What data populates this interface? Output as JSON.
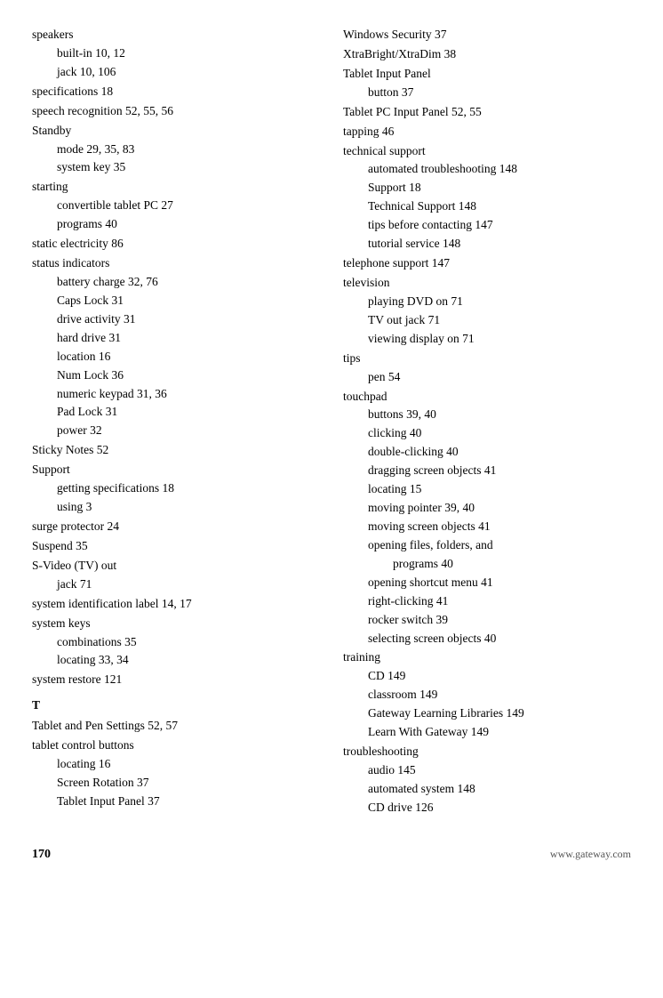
{
  "left_column": [
    {
      "type": "entry",
      "level": "main",
      "text": "speakers"
    },
    {
      "type": "entry",
      "level": "sub",
      "text": "built-in  10,  12"
    },
    {
      "type": "entry",
      "level": "sub",
      "text": "jack  10,  106"
    },
    {
      "type": "entry",
      "level": "main",
      "text": "specifications  18"
    },
    {
      "type": "entry",
      "level": "main",
      "text": "speech recognition  52,  55,  56"
    },
    {
      "type": "entry",
      "level": "main",
      "text": "Standby"
    },
    {
      "type": "entry",
      "level": "sub",
      "text": "mode  29,  35,  83"
    },
    {
      "type": "entry",
      "level": "sub",
      "text": "system key  35"
    },
    {
      "type": "entry",
      "level": "main",
      "text": "starting"
    },
    {
      "type": "entry",
      "level": "sub",
      "text": "convertible tablet PC  27"
    },
    {
      "type": "entry",
      "level": "sub",
      "text": "programs  40"
    },
    {
      "type": "entry",
      "level": "main",
      "text": "static electricity  86"
    },
    {
      "type": "entry",
      "level": "main",
      "text": "status indicators"
    },
    {
      "type": "entry",
      "level": "sub",
      "text": "battery charge  32,  76"
    },
    {
      "type": "entry",
      "level": "sub",
      "text": "Caps Lock  31"
    },
    {
      "type": "entry",
      "level": "sub",
      "text": "drive activity  31"
    },
    {
      "type": "entry",
      "level": "sub",
      "text": "hard drive  31"
    },
    {
      "type": "entry",
      "level": "sub",
      "text": "location  16"
    },
    {
      "type": "entry",
      "level": "sub",
      "text": "Num Lock  36"
    },
    {
      "type": "entry",
      "level": "sub",
      "text": "numeric keypad  31,  36"
    },
    {
      "type": "entry",
      "level": "sub",
      "text": "Pad Lock  31"
    },
    {
      "type": "entry",
      "level": "sub",
      "text": "power  32"
    },
    {
      "type": "entry",
      "level": "main",
      "text": "Sticky Notes  52"
    },
    {
      "type": "entry",
      "level": "main",
      "text": "Support"
    },
    {
      "type": "entry",
      "level": "sub",
      "text": "getting specifications  18"
    },
    {
      "type": "entry",
      "level": "sub",
      "text": "using  3"
    },
    {
      "type": "entry",
      "level": "main",
      "text": "surge protector  24"
    },
    {
      "type": "entry",
      "level": "main",
      "text": "Suspend  35"
    },
    {
      "type": "entry",
      "level": "main",
      "text": "S-Video (TV) out"
    },
    {
      "type": "entry",
      "level": "sub",
      "text": "jack  71"
    },
    {
      "type": "entry",
      "level": "main",
      "text": "system identification label  14,  17"
    },
    {
      "type": "entry",
      "level": "main",
      "text": "system keys"
    },
    {
      "type": "entry",
      "level": "sub",
      "text": "combinations  35"
    },
    {
      "type": "entry",
      "level": "sub",
      "text": "locating  33,  34"
    },
    {
      "type": "entry",
      "level": "main",
      "text": "system restore  121"
    },
    {
      "type": "spacer"
    },
    {
      "type": "letter",
      "text": "T"
    },
    {
      "type": "entry",
      "level": "main",
      "text": "Tablet and Pen Settings  52,  57"
    },
    {
      "type": "entry",
      "level": "main",
      "text": "tablet control buttons"
    },
    {
      "type": "entry",
      "level": "sub",
      "text": "locating  16"
    },
    {
      "type": "entry",
      "level": "sub",
      "text": "Screen Rotation  37"
    },
    {
      "type": "entry",
      "level": "sub",
      "text": "Tablet Input Panel  37"
    }
  ],
  "right_column": [
    {
      "type": "entry",
      "level": "main",
      "text": "Windows Security  37"
    },
    {
      "type": "entry",
      "level": "main",
      "text": "XtraBright/XtraDim  38"
    },
    {
      "type": "entry",
      "level": "main-noindent",
      "text": "Tablet Input Panel"
    },
    {
      "type": "entry",
      "level": "sub",
      "text": "button  37"
    },
    {
      "type": "entry",
      "level": "main-noindent",
      "text": "Tablet PC Input Panel  52,  55"
    },
    {
      "type": "entry",
      "level": "main-noindent",
      "text": "tapping  46"
    },
    {
      "type": "entry",
      "level": "main-noindent",
      "text": "technical support"
    },
    {
      "type": "entry",
      "level": "sub",
      "text": "automated troubleshooting  148"
    },
    {
      "type": "entry",
      "level": "sub",
      "text": "Support  18"
    },
    {
      "type": "entry",
      "level": "sub",
      "text": "Technical Support  148"
    },
    {
      "type": "entry",
      "level": "sub",
      "text": "tips before contacting  147"
    },
    {
      "type": "entry",
      "level": "sub",
      "text": "tutorial service  148"
    },
    {
      "type": "entry",
      "level": "main-noindent",
      "text": "telephone support  147"
    },
    {
      "type": "entry",
      "level": "main-noindent",
      "text": "television"
    },
    {
      "type": "entry",
      "level": "sub",
      "text": "playing DVD on  71"
    },
    {
      "type": "entry",
      "level": "sub",
      "text": "TV out jack  71"
    },
    {
      "type": "entry",
      "level": "sub",
      "text": "viewing display on  71"
    },
    {
      "type": "entry",
      "level": "main-noindent",
      "text": "tips"
    },
    {
      "type": "entry",
      "level": "sub",
      "text": "pen  54"
    },
    {
      "type": "entry",
      "level": "main-noindent",
      "text": "touchpad"
    },
    {
      "type": "entry",
      "level": "sub",
      "text": "buttons  39,  40"
    },
    {
      "type": "entry",
      "level": "sub",
      "text": "clicking  40"
    },
    {
      "type": "entry",
      "level": "sub",
      "text": "double-clicking  40"
    },
    {
      "type": "entry",
      "level": "sub",
      "text": "dragging screen objects  41"
    },
    {
      "type": "entry",
      "level": "sub",
      "text": "locating  15"
    },
    {
      "type": "entry",
      "level": "sub",
      "text": "moving pointer  39,  40"
    },
    {
      "type": "entry",
      "level": "sub",
      "text": "moving screen objects  41"
    },
    {
      "type": "entry",
      "level": "sub",
      "text": "opening files, folders, and"
    },
    {
      "type": "entry",
      "level": "subsub",
      "text": "programs  40"
    },
    {
      "type": "entry",
      "level": "sub",
      "text": "opening shortcut menu  41"
    },
    {
      "type": "entry",
      "level": "sub",
      "text": "right-clicking  41"
    },
    {
      "type": "entry",
      "level": "sub",
      "text": "rocker switch  39"
    },
    {
      "type": "entry",
      "level": "sub",
      "text": "selecting screen objects  40"
    },
    {
      "type": "entry",
      "level": "main-noindent",
      "text": "training"
    },
    {
      "type": "entry",
      "level": "sub",
      "text": "CD  149"
    },
    {
      "type": "entry",
      "level": "sub",
      "text": "classroom  149"
    },
    {
      "type": "entry",
      "level": "sub",
      "text": "Gateway Learning Libraries  149"
    },
    {
      "type": "entry",
      "level": "sub",
      "text": "Learn With Gateway  149"
    },
    {
      "type": "entry",
      "level": "main-noindent",
      "text": "troubleshooting"
    },
    {
      "type": "entry",
      "level": "sub",
      "text": "audio  145"
    },
    {
      "type": "entry",
      "level": "sub",
      "text": "automated system  148"
    },
    {
      "type": "entry",
      "level": "sub",
      "text": "CD drive  126"
    }
  ],
  "footer": {
    "page_number": "170",
    "website": "www.gateway.com"
  }
}
